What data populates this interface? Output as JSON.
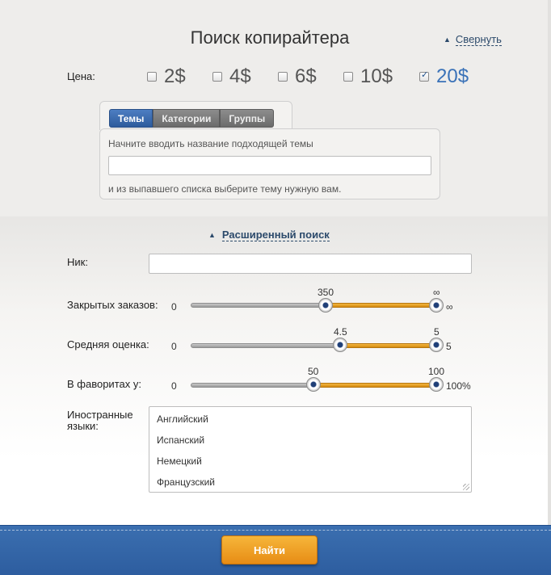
{
  "header": {
    "title": "Поиск копирайтера",
    "collapse_label": "Свернуть"
  },
  "price": {
    "label": "Цена:",
    "options": [
      {
        "label": "2$",
        "checked": false
      },
      {
        "label": "4$",
        "checked": false
      },
      {
        "label": "6$",
        "checked": false
      },
      {
        "label": "10$",
        "checked": false
      },
      {
        "label": "20$",
        "checked": true
      }
    ]
  },
  "topics": {
    "tabs": [
      "Темы",
      "Категории",
      "Группы"
    ],
    "active_tab": "Темы",
    "hint_top": "Начните вводить название подходящей темы",
    "input_value": "",
    "hint_bottom": "и из выпавшего списка выберите тему нужную вам."
  },
  "advanced": {
    "link_label": "Расширенный поиск",
    "nick_label": "Ник:",
    "nick_value": "",
    "sliders": [
      {
        "label": "Закрытых заказов:",
        "min_label": "0",
        "max_label": "∞",
        "low_label": "350",
        "high_label": "∞",
        "low_fraction": 0.55,
        "high_fraction": 1.0
      },
      {
        "label": "Средняя оценка:",
        "min_label": "0",
        "max_label": "5",
        "low_label": "4.5",
        "high_label": "5",
        "low_fraction": 0.61,
        "high_fraction": 1.0
      },
      {
        "label": "В фаворитах у:",
        "min_label": "0",
        "max_label": "100%",
        "low_label": "50",
        "high_label": "100",
        "low_fraction": 0.5,
        "high_fraction": 1.0
      }
    ],
    "languages_label": "Иностранные языки:",
    "languages": [
      "Английский",
      "Испанский",
      "Немецкий",
      "Французский"
    ]
  },
  "footer": {
    "search_button": "Найти"
  },
  "colors": {
    "accent_blue": "#3a72b8",
    "slider_orange": "#e79a1e",
    "footer_blue": "#2d5d9f",
    "button_orange": "#ef9f22"
  }
}
